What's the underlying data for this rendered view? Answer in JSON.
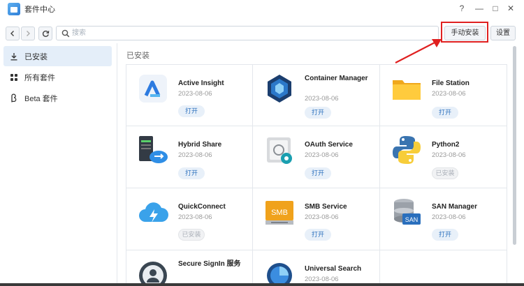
{
  "window": {
    "title": "套件中心",
    "controls": {
      "help": "?",
      "minimize": "—",
      "maximize": "□",
      "close": "✕"
    }
  },
  "toolbar": {
    "search_placeholder": "搜索",
    "manual_install_label": "手动安装",
    "settings_label": "设置"
  },
  "sidebar": {
    "items": [
      {
        "label": "已安装",
        "icon": "download-icon",
        "active": true
      },
      {
        "label": "所有套件",
        "icon": "grid-icon",
        "active": false
      },
      {
        "label": "Beta 套件",
        "icon": "beta-icon",
        "active": false
      }
    ]
  },
  "main": {
    "section_title": "已安装",
    "packages": [
      {
        "name": "Active Insight",
        "date": "2023-08-06",
        "action": "打开",
        "enabled": true,
        "icon": "active-insight-icon"
      },
      {
        "name": "Container Manager",
        "date": "2023-08-06",
        "action": "打开",
        "enabled": true,
        "icon": "container-manager-icon"
      },
      {
        "name": "File Station",
        "date": "2023-08-06",
        "action": "打开",
        "enabled": true,
        "icon": "file-station-icon"
      },
      {
        "name": "Hybrid Share",
        "date": "2023-08-06",
        "action": "打开",
        "enabled": true,
        "icon": "hybrid-share-icon"
      },
      {
        "name": "OAuth Service",
        "date": "2023-08-06",
        "action": "打开",
        "enabled": true,
        "icon": "oauth-service-icon"
      },
      {
        "name": "Python2",
        "date": "2023-08-06",
        "action": "已安装",
        "enabled": false,
        "icon": "python-icon"
      },
      {
        "name": "QuickConnect",
        "date": "2023-08-06",
        "action": "已安装",
        "enabled": false,
        "icon": "quickconnect-icon"
      },
      {
        "name": "SMB Service",
        "date": "2023-08-06",
        "action": "打开",
        "enabled": true,
        "icon": "smb-service-icon"
      },
      {
        "name": "SAN Manager",
        "date": "2023-08-06",
        "action": "打开",
        "enabled": true,
        "icon": "san-manager-icon"
      },
      {
        "name": "Secure SignIn 服务",
        "date": "",
        "action": "",
        "enabled": false,
        "icon": "secure-signin-icon"
      },
      {
        "name": "Universal Search",
        "date": "2023-08-06",
        "action": "",
        "enabled": false,
        "icon": "universal-search-icon"
      }
    ],
    "icon_labels": {
      "smb": "SMB",
      "san": "SAN"
    }
  },
  "colors": {
    "accent": "#2a6fbd",
    "highlight": "#e02020",
    "sidebar_active": "#e4eef9"
  }
}
